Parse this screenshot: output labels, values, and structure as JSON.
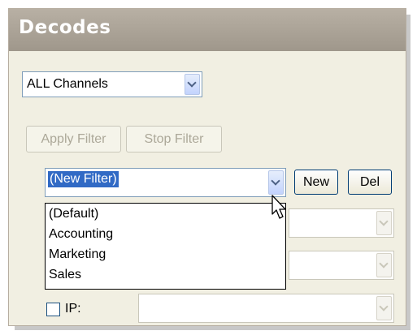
{
  "panel": {
    "title": "Decodes"
  },
  "channel_select": {
    "value": "ALL Channels"
  },
  "filter_buttons": {
    "apply": "Apply Filter",
    "stop": "Stop Filter"
  },
  "filter_select": {
    "value": "(New Filter)",
    "new_label": "New",
    "del_label": "Del"
  },
  "filter_options": [
    "(Default)",
    "Accounting",
    "Marketing",
    "Sales"
  ],
  "ip_row": {
    "label": "IP:",
    "checked": false
  },
  "icons": {
    "dropdown": "chevron-down-icon",
    "cursor": "mouse-pointer-icon"
  }
}
